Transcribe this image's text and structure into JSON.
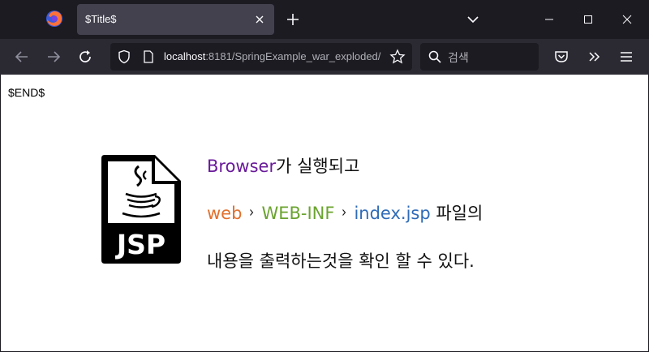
{
  "browser": {
    "tab_title": "$Title$",
    "url_host": "localhost",
    "url_path": ":8181/SpringExample_war_exploded/",
    "search_placeholder": "검색"
  },
  "page": {
    "end_text": "$END$",
    "line1": {
      "highlight": "Browser",
      "rest": "가 실행되고"
    },
    "line2": {
      "path": [
        "web",
        "WEB-INF",
        "index.jsp"
      ],
      "rest": " 파일의"
    },
    "line3": "내용을 출력하는것을 확인 할 수 있다.",
    "icon_label": "JSP"
  },
  "colors": {
    "browser_purple": "#6a1b9a",
    "web_orange": "#e2702c",
    "webinf_green": "#6aa32e",
    "indexjsp_blue": "#2e6bb8"
  },
  "icons": [
    "firefox-logo-icon",
    "close-icon",
    "plus-icon",
    "chevron-down-icon",
    "minimize-icon",
    "maximize-icon",
    "window-close-icon",
    "back-arrow-icon",
    "forward-arrow-icon",
    "reload-icon",
    "shield-icon",
    "page-icon",
    "star-icon",
    "search-icon",
    "pocket-icon",
    "overflow-icon",
    "menu-icon",
    "jsp-file-icon",
    "chevron-right-icon"
  ]
}
